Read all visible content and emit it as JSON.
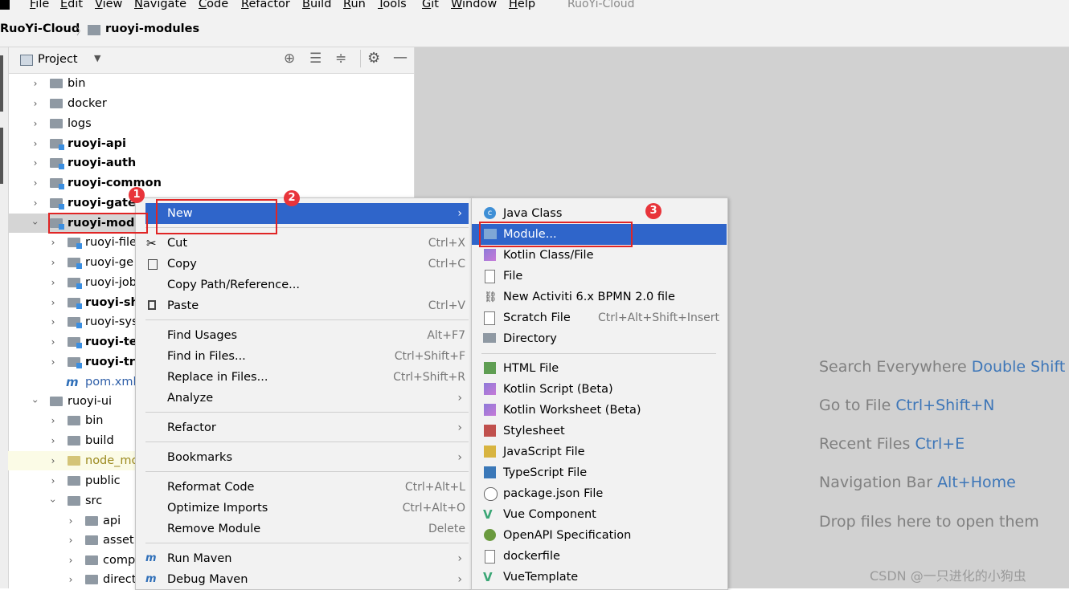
{
  "menu_bar": {
    "items": [
      "File",
      "Edit",
      "View",
      "Navigate",
      "Code",
      "Refactor",
      "Build",
      "Run",
      "Tools",
      "Git",
      "Window",
      "Help"
    ],
    "window_title": "RuoYi-Cloud"
  },
  "breadcrumb": {
    "root": "RuoYi-Cloud",
    "separator": "〉",
    "current": "ruoyi-modules"
  },
  "project_panel": {
    "title": "Project"
  },
  "tree": [
    {
      "label": "bin",
      "bold": false
    },
    {
      "label": "docker",
      "bold": false
    },
    {
      "label": "logs",
      "bold": false
    },
    {
      "label": "ruoyi-api",
      "bold": true
    },
    {
      "label": "ruoyi-auth",
      "bold": true
    },
    {
      "label": "ruoyi-common",
      "bold": true
    },
    {
      "label": "ruoyi-gatew",
      "bold": true
    },
    {
      "label": "ruoyi-modu",
      "bold": true
    },
    {
      "label": "ruoyi-file",
      "bold": false
    },
    {
      "label": "ruoyi-ge",
      "bold": false
    },
    {
      "label": "ruoyi-job",
      "bold": false
    },
    {
      "label": "ruoyi-sh",
      "bold": true
    },
    {
      "label": "ruoyi-sys",
      "bold": false
    },
    {
      "label": "ruoyi-te",
      "bold": true
    },
    {
      "label": "ruoyi-tr",
      "bold": true
    },
    {
      "label": "pom.xml",
      "bold": false
    },
    {
      "label": "ruoyi-ui",
      "bold": false
    },
    {
      "label": "bin",
      "bold": false
    },
    {
      "label": "build",
      "bold": false
    },
    {
      "label": "node_mo",
      "bold": false
    },
    {
      "label": "public",
      "bold": false
    },
    {
      "label": "src",
      "bold": false
    },
    {
      "label": "api",
      "bold": false
    },
    {
      "label": "asset",
      "bold": false
    },
    {
      "label": "comp",
      "bold": false
    },
    {
      "label": "direct",
      "bold": false
    }
  ],
  "context_menu": [
    {
      "label": "New",
      "shortcut": "",
      "submenu": true,
      "selected": true
    },
    {
      "label": "Cut",
      "shortcut": "Ctrl+X"
    },
    {
      "label": "Copy",
      "shortcut": "Ctrl+C"
    },
    {
      "label": "Copy Path/Reference...",
      "shortcut": ""
    },
    {
      "label": "Paste",
      "shortcut": "Ctrl+V"
    },
    {
      "label": "Find Usages",
      "shortcut": "Alt+F7"
    },
    {
      "label": "Find in Files...",
      "shortcut": "Ctrl+Shift+F"
    },
    {
      "label": "Replace in Files...",
      "shortcut": "Ctrl+Shift+R"
    },
    {
      "label": "Analyze",
      "shortcut": "",
      "submenu": true
    },
    {
      "label": "Refactor",
      "shortcut": "",
      "submenu": true
    },
    {
      "label": "Bookmarks",
      "shortcut": "",
      "submenu": true
    },
    {
      "label": "Reformat Code",
      "shortcut": "Ctrl+Alt+L"
    },
    {
      "label": "Optimize Imports",
      "shortcut": "Ctrl+Alt+O"
    },
    {
      "label": "Remove Module",
      "shortcut": "Delete"
    },
    {
      "label": "Run Maven",
      "shortcut": "",
      "submenu": true
    },
    {
      "label": "Debug Maven",
      "shortcut": "",
      "submenu": true
    }
  ],
  "new_submenu": [
    {
      "label": "Java Class",
      "shortcut": ""
    },
    {
      "label": "Module...",
      "shortcut": "",
      "selected": true
    },
    {
      "label": "Kotlin Class/File",
      "shortcut": ""
    },
    {
      "label": "File",
      "shortcut": ""
    },
    {
      "label": "New Activiti 6.x BPMN 2.0 file",
      "shortcut": ""
    },
    {
      "label": "Scratch File",
      "shortcut": "Ctrl+Alt+Shift+Insert"
    },
    {
      "label": "Directory",
      "shortcut": ""
    },
    {
      "label": "HTML File",
      "shortcut": ""
    },
    {
      "label": "Kotlin Script (Beta)",
      "shortcut": ""
    },
    {
      "label": "Kotlin Worksheet (Beta)",
      "shortcut": ""
    },
    {
      "label": "Stylesheet",
      "shortcut": ""
    },
    {
      "label": "JavaScript File",
      "shortcut": ""
    },
    {
      "label": "TypeScript File",
      "shortcut": ""
    },
    {
      "label": "package.json File",
      "shortcut": ""
    },
    {
      "label": "Vue Component",
      "shortcut": ""
    },
    {
      "label": "OpenAPI Specification",
      "shortcut": ""
    },
    {
      "label": "dockerfile",
      "shortcut": ""
    },
    {
      "label": "VueTemplate",
      "shortcut": ""
    }
  ],
  "editor_hints": [
    {
      "text": "Search Everywhere",
      "key": "Double Shift"
    },
    {
      "text": "Go to File",
      "key": "Ctrl+Shift+N"
    },
    {
      "text": "Recent Files",
      "key": "Ctrl+E"
    },
    {
      "text": "Navigation Bar",
      "key": "Alt+Home"
    },
    {
      "text": "Drop files here to open them",
      "key": ""
    }
  ],
  "annotations": [
    "1",
    "2",
    "3"
  ],
  "watermark": "CSDN @一只进化的小狗虫",
  "colors": {
    "selection": "#2f65ca",
    "annotation_red": "#e02525",
    "hint_key": "#3d76b8"
  }
}
